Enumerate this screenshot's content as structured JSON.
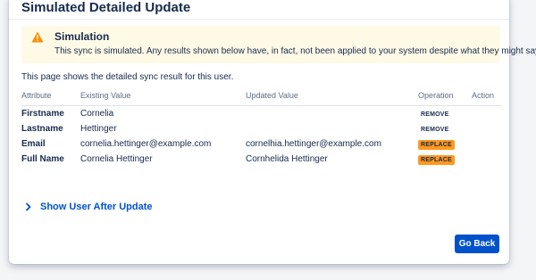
{
  "dialog": {
    "title": "Simulated Detailed Update"
  },
  "banner": {
    "icon": "warning-icon",
    "icon_color": "#ff8b00",
    "background": "#fffae6",
    "title": "Simulation",
    "text": "This sync is simulated. Any results shown below have, in fact, not been applied to your system despite what they might say"
  },
  "intro": "This page shows the detailed sync result for this user.",
  "table": {
    "headers": {
      "attribute": "Attribute",
      "existing": "Existing Value",
      "updated": "Updated Value",
      "operation": "Operation",
      "action": "Action"
    },
    "rows": [
      {
        "attribute": "Firstname",
        "existing": "Cornelia",
        "updated": "",
        "operation": "REMOVE"
      },
      {
        "attribute": "Lastname",
        "existing": "Hettinger",
        "updated": "",
        "operation": "REMOVE"
      },
      {
        "attribute": "Email",
        "existing": "cornelia.hettinger@example.com",
        "updated": "cornelhia.hettinger@example.com",
        "operation": "REPLACE"
      },
      {
        "attribute": "Full Name",
        "existing": "Cornelia Hettinger",
        "updated": "Cornhelida Hettinger",
        "operation": "REPLACE"
      }
    ]
  },
  "show_after": {
    "icon": "chevron-right-icon",
    "label": "Show User After Update"
  },
  "buttons": {
    "go_back": "Go Back"
  },
  "colors": {
    "primary": "#0052cc",
    "replace_badge": "#ff991f"
  }
}
